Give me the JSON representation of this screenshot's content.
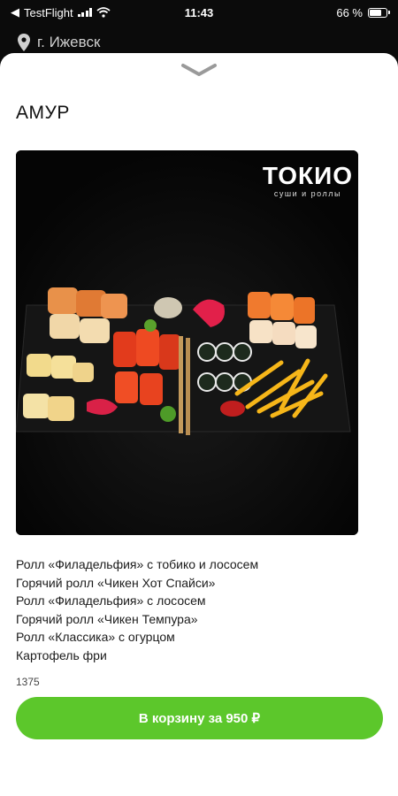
{
  "status_bar": {
    "carrier": "TestFlight",
    "time": "11:43",
    "battery": "66 %"
  },
  "location": {
    "city": "г. Ижевск",
    "icon": "location-pin-icon"
  },
  "product": {
    "title": "АМУР",
    "image_logo_name": "ТОКИО",
    "image_logo_sub": "суши и роллы",
    "composition": [
      "Ролл «Филадельфия» с тобико и лососем",
      "Горячий ролл «Чикен Хот Спайси»",
      "Ролл «Филадельфия» с лососем",
      "Горячий ролл «Чикен Темпура»",
      "Ролл «Классика» с огурцом",
      "Картофель фри"
    ],
    "weight": "1375"
  },
  "actions": {
    "add_to_cart_label": "В корзину за 950 ₽"
  },
  "colors": {
    "accent": "#5cc72b",
    "sheet": "#ffffff",
    "backdrop": "#0b0b0b"
  }
}
